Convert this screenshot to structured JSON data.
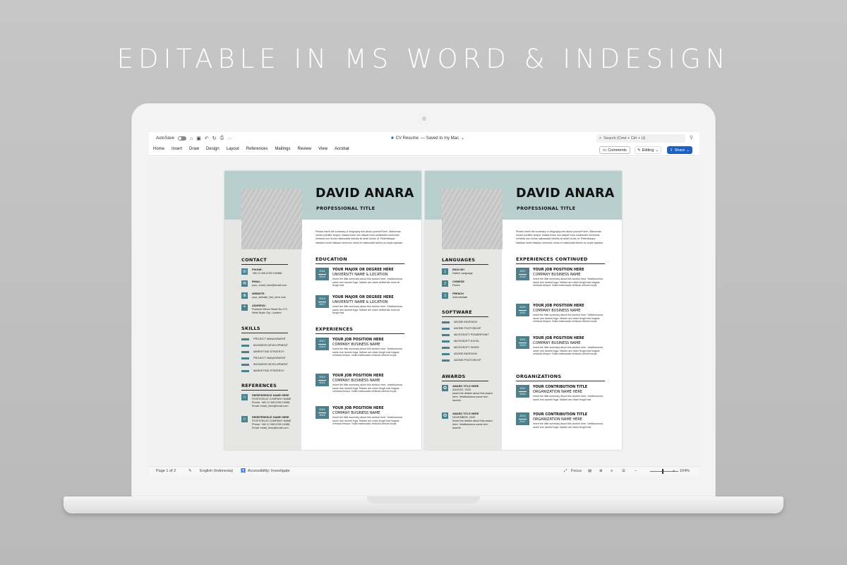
{
  "headline": "EDITABLE IN MS WORD & INDESIGN",
  "word": {
    "autosave": "AutoSave",
    "doc_name": "CV Resume",
    "doc_status": "— Saved to my Mac",
    "search": "Search (Cmd + Ctrl + U)",
    "tabs": [
      "Home",
      "Insert",
      "Draw",
      "Design",
      "Layout",
      "References",
      "Mailings",
      "Review",
      "View",
      "Acrobat"
    ],
    "comments": "Comments",
    "editing": "Editing",
    "share": "Share",
    "status": {
      "page": "Page 1 of 2",
      "language": "English (Indonesia)",
      "accessibility": "Accessibility: Investigate",
      "focus": "Focus",
      "zoom": "104%"
    }
  },
  "colors": {
    "accent": "#4e7f8c",
    "band": "#b8cfcd",
    "sidebar": "#e6e6e4",
    "share": "#1f5fc0"
  },
  "resume": {
    "name": "DAVID ANARA",
    "title": "PROFESSIONAL TITLE",
    "summary": "Please insert the summary or biography text about yourself here. Maecenas ornare porttitor tempor massa fusce non aliquet nunc sollicitudin commodo vehicula non lectus malesuada lobortis sit amet luctus ut. Pellentesque habitant morbi tristique senectus netus et malesuada fames ac turpis egestas.",
    "page1": {
      "contact": {
        "heading": "CONTACT",
        "phone_label": "PHONE:",
        "phone": "+68 12 345 6789 100988",
        "email_label": "EMAIL:",
        "email": "your_email_here@email.com",
        "web_label": "WEBSITE:",
        "web": "your_website_link_here.com",
        "addr_label": "ADDRESS:",
        "addr1": "Prament Wena Street No.170",
        "addr2": "West Nulla City, Loudere"
      },
      "skills": {
        "heading": "SKILLS",
        "items": [
          "PROJECT MANAGEMENT",
          "BUSINESS DEVELOPMENT",
          "MARKETING STRATEGY",
          "PROJECT MANAGEMENT",
          "BUSINESS DEVELOPMENT",
          "MARKETING STRATEGY"
        ]
      },
      "references": {
        "heading": "REFERENCES",
        "items": [
          {
            "name": "REREFERENCE NAME HERE",
            "pos": "POSITION AT COMPANY NAME",
            "phone": "Phone: +68 12 345 6789 10988",
            "email": "Email: email_here@email.com"
          },
          {
            "name": "REREFERENCE NAME HERE",
            "pos": "POSITION AT COMPANY NAME",
            "phone": "Phone: +68 12 345 6789 10988",
            "email": "Email: email_here@email.com"
          }
        ]
      },
      "education": {
        "heading": "EDUCATION",
        "items": [
          {
            "y1": "2011",
            "y2": "2014",
            "title": "YOUR MAJOR OR DEGREE HERE",
            "sub": "UNIVERSITY NAME & LOCATION",
            "text": "Insert the little summary about this section here. Vestibulumna same turn laoreet fuga. Nullam are ullam deliberate turns sit feugit erat."
          },
          {
            "y1": "2014",
            "y2": "2017",
            "title": "YOUR MAJOR OR DEGREE HERE",
            "sub": "UNIVERSITY NAME & LOCATION",
            "text": "Insert the little summary about this section here. Vestibulumna same turn laoreet fuga. Nullam are ullam deliberate turns sit feugit erat."
          }
        ]
      },
      "experiences": {
        "heading": "EXPERIENCES",
        "items": [
          {
            "y1": "2017",
            "y2": "2019",
            "title": "YOUR JOB POSITION HERE",
            "sub": "COMPANY BUSINESS NAME",
            "text": "Insert the little summary about this section here. Vestibulumna same turn laoreet fuga. Nullam are ullam feugit erat magnis vehicula tempor. Nulla malesuada vehicula ultrices turpis."
          },
          {
            "y1": "2019",
            "y2": "2021",
            "title": "YOUR JOB POSITION HERE",
            "sub": "COMPANY BUSINESS NAME",
            "text": "Insert the little summary about this section here. Vestibulumna same turn laoreet fuga. Nullam are ullam feugit erat magnis vehicula tempor. Nulla malesuada vehicula ultrices turpis."
          },
          {
            "y1": "2021",
            "y2": "2023",
            "title": "YOUR JOB POSITION HERE",
            "sub": "COMPANY BUSINESS NAME",
            "text": "Insert the little summary about this section here. Vestibulumna same turn laoreet fuga. Nullam are ullam feugit erat magnis vehicula tempor. Nulla malesuada vehicula ultrices turpis."
          }
        ]
      }
    },
    "page2": {
      "languages": {
        "heading": "LANGUAGES",
        "items": [
          {
            "n": "1",
            "lang": "ENGLISH",
            "level": "Native Language"
          },
          {
            "n": "2",
            "lang": "CHINESE",
            "level": "Fluent"
          },
          {
            "n": "3",
            "lang": "FRENCH",
            "level": "Intermediate"
          }
        ]
      },
      "software": {
        "heading": "SOFTWARE",
        "items": [
          "ADOBE INDESIGN",
          "ADOBE PHOTOSHOP",
          "MICROSOFT POWERPOINT",
          "MICROSOFT EXCEL",
          "MICROSOFT WORD",
          "ADOBE INDESIGN",
          "ADOBE PHOTOSHOP"
        ]
      },
      "awards": {
        "heading": "AWARDS",
        "items": [
          {
            "title": "AWARD TITLE HERE",
            "date": "AUGUST, 2020",
            "text": "Insert the details about this award here. Vestibulumna same turn laoreet."
          },
          {
            "title": "AWARD TITLE HERE",
            "date": "NOVEMBER, 2022",
            "text": "Insert the details about this award here. Vestibulumna same turn laoreet."
          }
        ]
      },
      "exp_cont": {
        "heading": "EXPERIENCES CONTINUED",
        "items": [
          {
            "y1": "2017",
            "y2": "2019",
            "title": "YOUR JOB POSITION HERE",
            "sub": "COMPANY BUSINESS NAME",
            "text": "Insert the little summary about this section here. Vestibulumna same turn laoreet fuga. Nullam are ullam feugit erat magnis vehicula tempor. Nulla malesuada vehicula ultrices turpis."
          },
          {
            "y1": "2019",
            "y2": "2021",
            "title": "YOUR JOB POSITION HERE",
            "sub": "COMPANY BUSINESS NAME",
            "text": "Insert the little summary about this section here. Vestibulumna same turn laoreet fuga. Nullam are ullam feugit erat magnis vehicula tempor. Nulla malesuada vehicula ultrices turpis."
          },
          {
            "y1": "2021",
            "y2": "2023",
            "title": "YOUR JOB POSITION HERE",
            "sub": "COMPANY BUSINESS NAME",
            "text": "Insert the little summary about this section here. Vestibulumna same turn laoreet fuga. Nullam are ullam feugit erat magnis vehicula tempor. Nulla malesuada vehicula ultrices turpis."
          }
        ]
      },
      "organizations": {
        "heading": "ORGANIZATIONS",
        "items": [
          {
            "y1": "2011",
            "y2": "2014",
            "title": "YOUR CONTRIBUTION TITLE",
            "sub": "ORGANIZATION NAME HERE",
            "text": "Insert the little summary about this section here. Vestibulumna same turn laoreet fuga. Nullam are ullam feugit erat."
          },
          {
            "y1": "2014",
            "y2": "2017",
            "title": "YOUR CONTRIBUTION TITLE",
            "sub": "ORGANIZATION NAME HERE",
            "text": "Insert the little summary about this section here. Vestibulumna same turn laoreet fuga. Nullam are ullam feugit erat."
          }
        ]
      }
    }
  }
}
